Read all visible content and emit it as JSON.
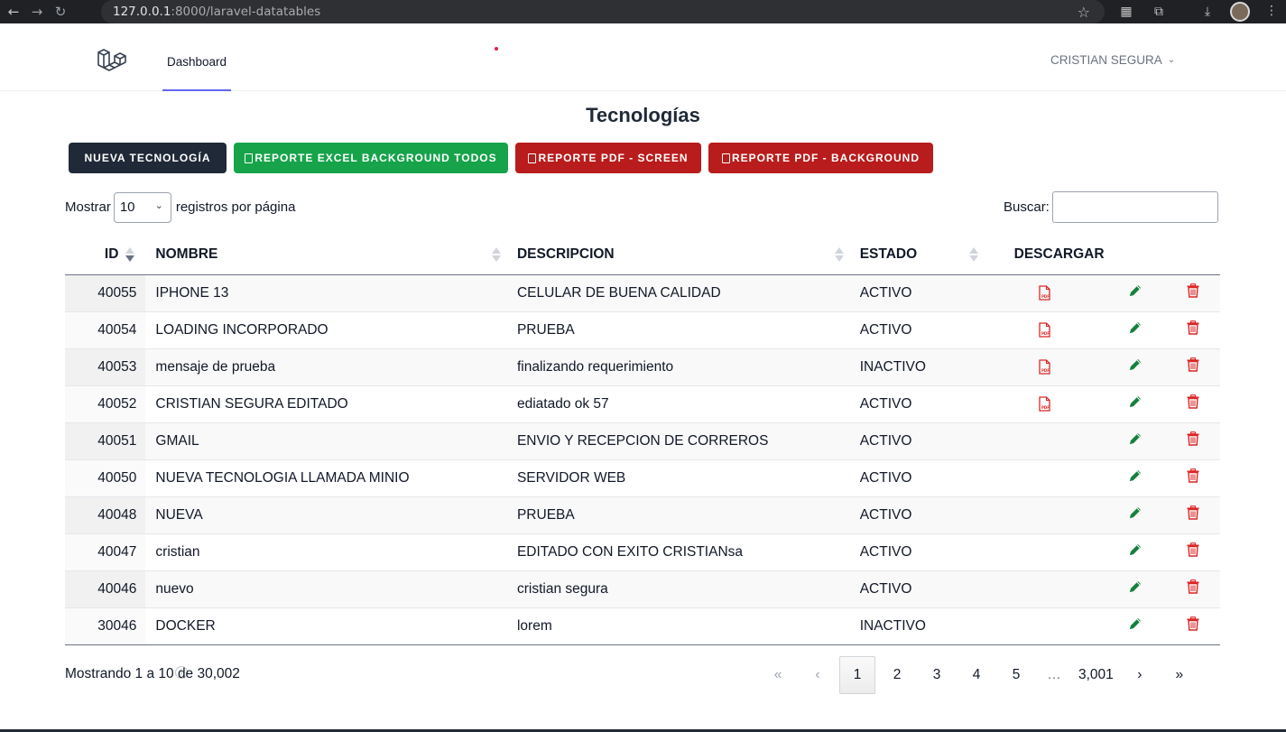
{
  "browser": {
    "url_host": "127.0.0.1",
    "url_rest": ":8000/laravel-datatables"
  },
  "nav": {
    "dashboard_label": "Dashboard",
    "user_name": "CRISTIAN SEGURA"
  },
  "page": {
    "title": "Tecnologías"
  },
  "buttons": {
    "nueva": "NUEVA TECNOLOGÍA",
    "excel": "REPORTE EXCEL BACKGROUND TODOS",
    "pdf_screen": "REPORTE PDF - SCREEN",
    "pdf_background": "REPORTE PDF - BACKGROUND"
  },
  "length": {
    "prefix": "Mostrar",
    "value": "10",
    "suffix": "registros por página"
  },
  "search": {
    "label": "Buscar:",
    "value": ""
  },
  "table": {
    "headers": [
      "ID",
      "NOMBRE",
      "DESCRIPCION",
      "ESTADO",
      "DESCARGAR"
    ],
    "rows": [
      {
        "id": "40055",
        "nombre": "IPHONE 13",
        "descripcion": "CELULAR DE BUENA CALIDAD",
        "estado": "ACTIVO",
        "pdf": true
      },
      {
        "id": "40054",
        "nombre": "LOADING INCORPORADO",
        "descripcion": "PRUEBA",
        "estado": "ACTIVO",
        "pdf": true
      },
      {
        "id": "40053",
        "nombre": "mensaje de prueba",
        "descripcion": "finalizando requerimiento",
        "estado": "INACTIVO",
        "pdf": true
      },
      {
        "id": "40052",
        "nombre": "CRISTIAN SEGURA EDITADO",
        "descripcion": "ediatado ok 57",
        "estado": "ACTIVO",
        "pdf": true
      },
      {
        "id": "40051",
        "nombre": "GMAIL",
        "descripcion": "ENVIO Y RECEPCION DE CORREROS",
        "estado": "ACTIVO",
        "pdf": false
      },
      {
        "id": "40050",
        "nombre": "NUEVA TECNOLOGIA LLAMADA MINIO",
        "descripcion": "SERVIDOR WEB",
        "estado": "ACTIVO",
        "pdf": false
      },
      {
        "id": "40048",
        "nombre": "NUEVA",
        "descripcion": "PRUEBA",
        "estado": "ACTIVO",
        "pdf": false
      },
      {
        "id": "40047",
        "nombre": "cristian",
        "descripcion": "EDITADO CON EXITO CRISTIANsa",
        "estado": "ACTIVO",
        "pdf": false
      },
      {
        "id": "40046",
        "nombre": "nuevo",
        "descripcion": "cristian segura",
        "estado": "ACTIVO",
        "pdf": false
      },
      {
        "id": "30046",
        "nombre": "DOCKER",
        "descripcion": "lorem",
        "estado": "INACTIVO",
        "pdf": false
      }
    ]
  },
  "footer": {
    "info": "Mostrando 1 a 10 de 30,002",
    "pages": [
      "«",
      "‹",
      "1",
      "2",
      "3",
      "4",
      "5",
      "…",
      "3,001",
      "›",
      "»"
    ],
    "current_page": "1"
  },
  "colors": {
    "dark": "#1f2937",
    "green": "#16a34a",
    "red": "#b91c1c",
    "edit_icon": "#15803d",
    "delete_icon": "#dc2626",
    "pdf_icon": "#dc2626",
    "nav_accent": "#6366f1"
  },
  "icons": {
    "row_download": "file-pdf-icon",
    "row_edit": "pencil-icon",
    "row_delete": "trash-icon"
  }
}
